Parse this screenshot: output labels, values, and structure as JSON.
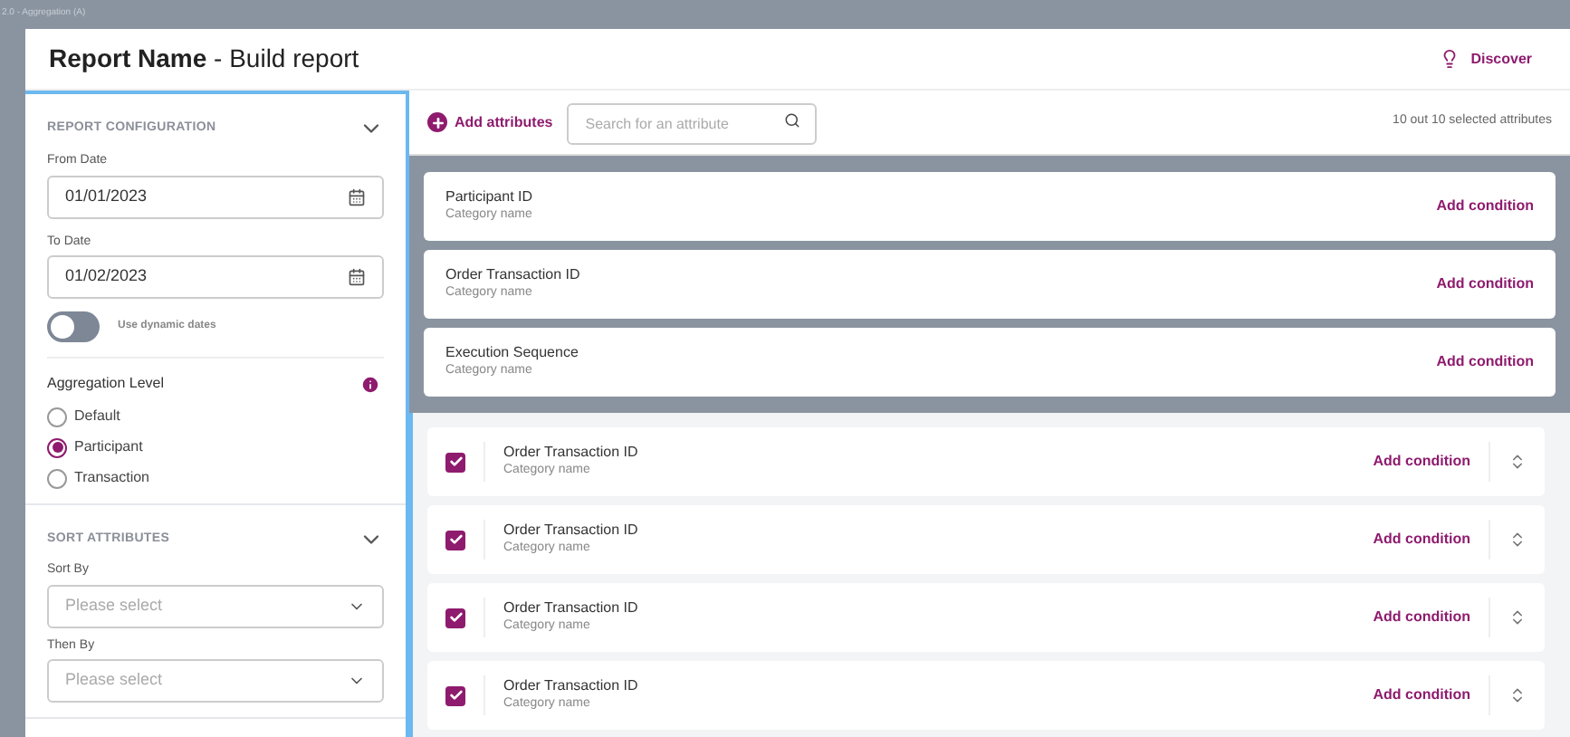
{
  "frame_title": "2.0 - Aggregation (A)",
  "header": {
    "title_bold": "Report Name",
    "title_rest": " - Build report",
    "discover": "Discover"
  },
  "config": {
    "section_title": "REPORT CONFIGURATION",
    "expanded": true,
    "from_label": "From Date",
    "from_value": "01/01/2023",
    "to_label": "To Date",
    "to_value": "01/02/2023",
    "dynamic_dates": {
      "label": "Use dynamic dates",
      "on": false
    },
    "aggregation_label": "Aggregation Level",
    "aggregation_options": [
      {
        "label": "Default",
        "selected": false
      },
      {
        "label": "Participant",
        "selected": true
      },
      {
        "label": "Transaction",
        "selected": false
      }
    ]
  },
  "sort": {
    "section_title": "SORT ATTRIBUTES",
    "expanded": true,
    "fields": [
      {
        "label": "Sort By",
        "placeholder": "Please select"
      },
      {
        "label": "Then By",
        "placeholder": "Please select"
      }
    ]
  },
  "toolbar": {
    "add_button": "Add attributes",
    "search_placeholder": "Search for an attribute",
    "count": "10 out 10 selected attributes"
  },
  "pinned_attributes": [
    {
      "name": "Participant ID",
      "category": "Category name",
      "action": "Add condition"
    },
    {
      "name": "Order Transaction ID",
      "category": "Category name",
      "action": "Add condition"
    },
    {
      "name": "Execution Sequence",
      "category": "Category name",
      "action": "Add condition"
    }
  ],
  "attributes": [
    {
      "name": "Order Transaction ID",
      "category": "Category name",
      "action": "Add condition",
      "checked": true
    },
    {
      "name": "Order Transaction ID",
      "category": "Category name",
      "action": "Add condition",
      "checked": true
    },
    {
      "name": "Order Transaction ID",
      "category": "Category name",
      "action": "Add condition",
      "checked": true
    },
    {
      "name": "Order Transaction ID",
      "category": "Category name",
      "action": "Add condition",
      "checked": true
    }
  ]
}
